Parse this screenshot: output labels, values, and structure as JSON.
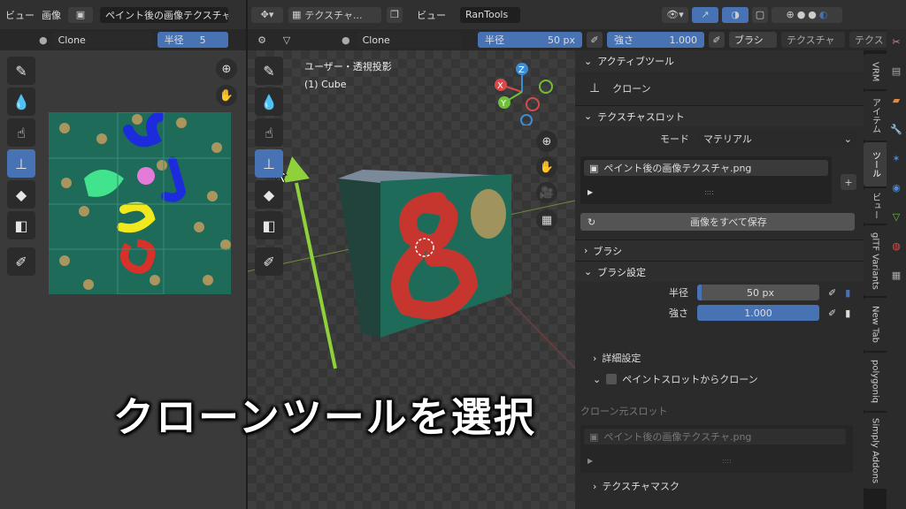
{
  "left": {
    "menu_view": "ビュー",
    "menu_image": "画像",
    "image_name": "ペイント後の画像テクスチャ",
    "brush_name": "Clone",
    "radius_label": "半径",
    "radius_value": "5"
  },
  "header": {
    "menu_view": "ビュー",
    "addon_dropdown": "RanTools",
    "texture_dropdown": "テクスチャ..."
  },
  "toolbar": {
    "brush_name": "Clone",
    "radius_label": "半径",
    "radius_value": "50 px",
    "strength_label": "強さ",
    "strength_value": "1.000",
    "brush_tab": "ブラシ",
    "texture_tab": "テクスチャ",
    "texture_tab2": "テクス"
  },
  "viewport": {
    "view_label": "ユーザー・透視投影",
    "object_label": "(1) Cube",
    "gizmo_x": "X",
    "gizmo_y": "Y",
    "gizmo_z": "Z"
  },
  "sidebar": {
    "active_tool_header": "アクティブツール",
    "active_tool_name": "クローン",
    "texture_slots_header": "テクスチャスロット",
    "mode_label": "モード",
    "mode_value": "マテリアル",
    "slot_item": "ペイント後の画像テクスチャ.png",
    "save_all_button": "画像をすべて保存",
    "brush_header": "ブラシ",
    "brush_settings_header": "ブラシ設定",
    "radius_label": "半径",
    "radius_value": "50 px",
    "strength_label": "強さ",
    "strength_value": "1.000",
    "advanced_label": "詳細設定",
    "clone_from_slot_label": "ペイントスロットからクローン",
    "clone_source_label": "クローン元スロット",
    "clone_source_item": "ペイント後の画像テクスチャ.png",
    "texture_mask_label": "テクスチャマスク"
  },
  "vertical_tabs": [
    "VRM",
    "アイテム",
    "ツール",
    "ビュー",
    "glTF Variants",
    "New Tab",
    "polygoniq",
    "Simply Addons"
  ],
  "subtitle": "クローンツールを選択",
  "colors": {
    "accent": "#4772b3",
    "texture_bg": "#1e6b5a",
    "arrow": "#8fd13a",
    "paint_red": "#d8312a"
  },
  "icons": {
    "active_tool": "clone-stamp-icon",
    "zoom": "zoom-icon",
    "hand": "hand-pan-icon",
    "camera": "camera-icon",
    "grid": "grid-icon"
  }
}
